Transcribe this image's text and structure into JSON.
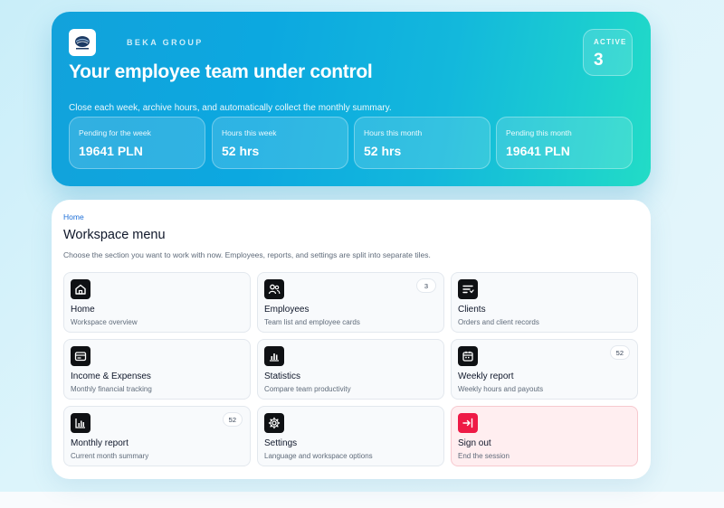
{
  "brand": {
    "name": "BEKA GROUP"
  },
  "hero": {
    "title": "Your employee team under control",
    "subtitle": "Close each week, archive hours, and automatically collect the monthly summary.",
    "active": {
      "label": "ACTIVE",
      "value": "3"
    },
    "stats": [
      {
        "label": "Pending for the week",
        "value": "19641 PLN"
      },
      {
        "label": "Hours this week",
        "value": "52 hrs"
      },
      {
        "label": "Hours this month",
        "value": "52 hrs"
      },
      {
        "label": "Pending this month",
        "value": "19641 PLN"
      }
    ]
  },
  "menu": {
    "breadcrumb": "Home",
    "title": "Workspace menu",
    "description": "Choose the section you want to work with now. Employees, reports, and settings are split into separate tiles.",
    "tiles": [
      {
        "title": "Home",
        "subtitle": "Workspace overview",
        "icon": "home-icon"
      },
      {
        "title": "Employees",
        "subtitle": "Team list and employee cards",
        "icon": "users-icon",
        "count": "3"
      },
      {
        "title": "Clients",
        "subtitle": "Orders and client records",
        "icon": "clients-icon"
      },
      {
        "title": "Income & Expenses",
        "subtitle": "Monthly financial tracking",
        "icon": "wallet-icon"
      },
      {
        "title": "Statistics",
        "subtitle": "Compare team productivity",
        "icon": "bar-chart-icon"
      },
      {
        "title": "Weekly report",
        "subtitle": "Weekly hours and payouts",
        "icon": "calendar-icon",
        "count": "52"
      },
      {
        "title": "Monthly report",
        "subtitle": "Current month summary",
        "icon": "chart-icon",
        "count": "52"
      },
      {
        "title": "Settings",
        "subtitle": "Language and workspace options",
        "icon": "gear-icon"
      },
      {
        "title": "Sign out",
        "subtitle": "End the session",
        "icon": "sign-out-icon"
      }
    ]
  },
  "colors": {
    "hero_start": "#12a2db",
    "hero_end": "#22dcc6",
    "link": "#1d6fd8",
    "danger": "#ee1a46",
    "icon_bg": "#0f1114"
  }
}
